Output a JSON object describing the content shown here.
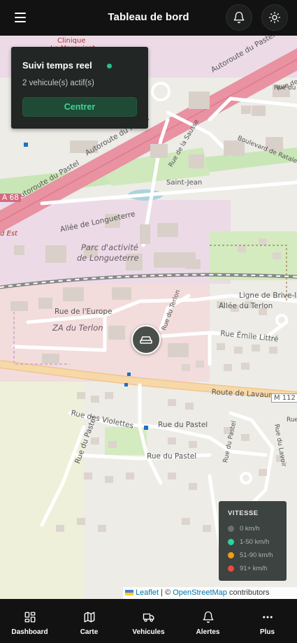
{
  "header": {
    "title": "Tableau de bord",
    "menu_icon": "hamburger-menu-icon",
    "notif_icon": "bell-icon",
    "theme_icon": "sun-icon"
  },
  "panel": {
    "title": "Suivi temps reel",
    "status_color": "#22c38e",
    "subtitle": "2 vehicule(s) actif(s)",
    "button": "Centrer"
  },
  "legend": {
    "title": "VITESSE",
    "items": [
      {
        "label": "0 km/h",
        "color": "#6b716e"
      },
      {
        "label": "1-50 km/h",
        "color": "#2ad4a0"
      },
      {
        "label": "51-90 km/h",
        "color": "#f39c12"
      },
      {
        "label": "91+ km/h",
        "color": "#e74c3c"
      }
    ]
  },
  "attribution": {
    "leaflet": "Leaflet",
    "separator": "| ©",
    "osm": "OpenStreetMap",
    "suffix": "contributors"
  },
  "map_labels": {
    "clinique": "Clinique",
    "marquisat": "Le Marquisat",
    "autoroute1": "Autoroute du Pastel",
    "autoroute2": "Autoroute du Pastel",
    "autoroute3": "Autoroute du Pastel",
    "sausse": "Rue de la Sausse",
    "ratalens": "Boulevard de Ratalens",
    "rue_de_la": "Rue de la",
    "saint_jean": "Saint-Jean",
    "a68": "A 68",
    "d_est": "d Est",
    "allee_longueterre": "Allée de Longueterre",
    "parc1": "Parc d'activité",
    "parc2": "de Longueterre",
    "ligne": "Ligne de Brive-la-Gai",
    "allee_terlon": "Allée du Terlon",
    "rue_europe": "Rue de l'Europe",
    "rue_terlon": "Rue du Terlon",
    "za_terlon": "ZA du Terlon",
    "emile": "Rue Émile Littré",
    "lavaur": "Route de Lavaur",
    "m112": "M 112",
    "violettes": "Rue des Violettes",
    "pastel1": "Rue du Pastel",
    "pastel2": "Rue du Pastel",
    "pastel3": "Rue du Pastel",
    "pastel_v": "Rue du Pastel",
    "lavoir": "Rue du Lavoir",
    "rue_du": "Rue du",
    "rue_d": "Rue d"
  },
  "vehicle_icon": "car-icon",
  "nav": [
    {
      "label": "Dashboard",
      "icon": "dashboard-grid-icon"
    },
    {
      "label": "Carte",
      "icon": "map-icon"
    },
    {
      "label": "Vehicules",
      "icon": "truck-icon"
    },
    {
      "label": "Alertes",
      "icon": "bell-icon"
    },
    {
      "label": "Plus",
      "icon": "more-dots-icon"
    }
  ]
}
